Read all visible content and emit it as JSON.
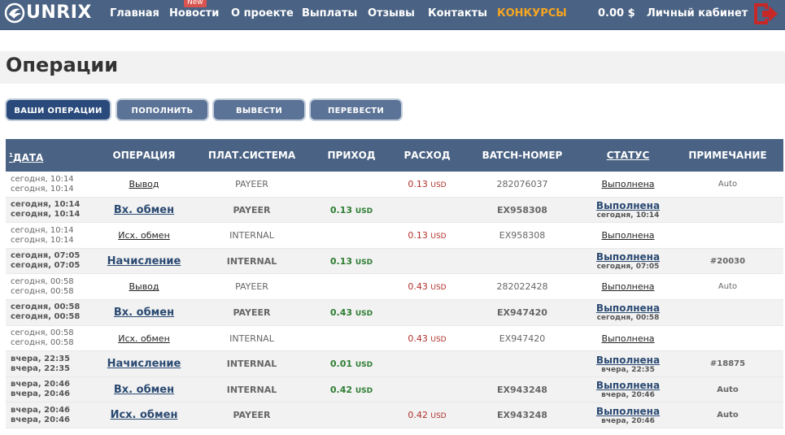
{
  "header": {
    "logo_text": "UNRIX",
    "nav": [
      {
        "label": "Главная"
      },
      {
        "label": "Новости",
        "badge": "New"
      },
      {
        "label": "О проекте"
      },
      {
        "label": "Выплаты"
      },
      {
        "label": "Отзывы"
      },
      {
        "label": "Контакты"
      },
      {
        "label": "КОНКУРСЫ"
      }
    ],
    "balance": "0.00 $",
    "cabinet": "Личный кабинет",
    "colors": {
      "bar": "#4a6283",
      "contest": "#f5a623",
      "logout": "#c62828"
    }
  },
  "page": {
    "title": "Операции"
  },
  "buttons": [
    {
      "label": "ВАШИ ОПЕРАЦИИ",
      "active": true
    },
    {
      "label": "ПОПОЛНИТЬ"
    },
    {
      "label": "ВЫВЕСТИ"
    },
    {
      "label": "ПЕРЕВЕСТИ"
    }
  ],
  "table": {
    "sort_marker": "1",
    "headers": [
      "ДАТА",
      "ОПЕРАЦИЯ",
      "ПЛАТ.СИСТЕМА",
      "ПРИХОД",
      "РАСХОД",
      "BATCH-НОМЕР",
      "СТАТУС",
      "ПРИМЕЧАНИЕ"
    ],
    "rows": [
      {
        "bold": false,
        "date1": "сегодня, 10:14",
        "date2": "сегодня, 10:14",
        "op": "Вывод",
        "sys": "PAYEER",
        "inc": "",
        "inc_unit": "",
        "exp": "0.13",
        "exp_unit": "USD",
        "batch": "282076037",
        "status": "Выполнена",
        "status_time": "",
        "note": "Auto"
      },
      {
        "bold": true,
        "date1": "сегодня, 10:14",
        "date2": "сегодня, 10:14",
        "op": "Вх. обмен",
        "sys": "PAYEER",
        "inc": "0.13",
        "inc_unit": "USD",
        "exp": "",
        "exp_unit": "",
        "batch": "EX958308",
        "status": "Выполнена",
        "status_time": "сегодня, 10:14",
        "note": ""
      },
      {
        "bold": false,
        "date1": "сегодня, 10:14",
        "date2": "сегодня, 10:14",
        "op": "Исх. обмен",
        "sys": "INTERNAL",
        "inc": "",
        "inc_unit": "",
        "exp": "0.13",
        "exp_unit": "USD",
        "batch": "EX958308",
        "status": "Выполнена",
        "status_time": "",
        "note": ""
      },
      {
        "bold": true,
        "date1": "сегодня, 07:05",
        "date2": "сегодня, 07:05",
        "op": "Начисление",
        "sys": "INTERNAL",
        "inc": "0.13",
        "inc_unit": "USD",
        "exp": "",
        "exp_unit": "",
        "batch": "",
        "status": "Выполнена",
        "status_time": "сегодня, 07:05",
        "note": "#20030"
      },
      {
        "bold": false,
        "date1": "сегодня, 00:58",
        "date2": "сегодня, 00:58",
        "op": "Вывод",
        "sys": "PAYEER",
        "inc": "",
        "inc_unit": "",
        "exp": "0.43",
        "exp_unit": "USD",
        "batch": "282022428",
        "status": "Выполнена",
        "status_time": "",
        "note": "Auto"
      },
      {
        "bold": true,
        "date1": "сегодня, 00:58",
        "date2": "сегодня, 00:58",
        "op": "Вх. обмен",
        "sys": "PAYEER",
        "inc": "0.43",
        "inc_unit": "USD",
        "exp": "",
        "exp_unit": "",
        "batch": "EX947420",
        "status": "Выполнена",
        "status_time": "сегодня, 00:58",
        "note": ""
      },
      {
        "bold": false,
        "date1": "сегодня, 00:58",
        "date2": "сегодня, 00:58",
        "op": "Исх. обмен",
        "sys": "INTERNAL",
        "inc": "",
        "inc_unit": "",
        "exp": "0.43",
        "exp_unit": "USD",
        "batch": "EX947420",
        "status": "Выполнена",
        "status_time": "",
        "note": ""
      },
      {
        "bold": true,
        "date1": "вчера, 22:35",
        "date2": "вчера, 22:35",
        "op": "Начисление",
        "sys": "INTERNAL",
        "inc": "0.01",
        "inc_unit": "USD",
        "exp": "",
        "exp_unit": "",
        "batch": "",
        "status": "Выполнена",
        "status_time": "вчера, 22:35",
        "note": "#18875"
      },
      {
        "bold": true,
        "date1": "вчера, 20:46",
        "date2": "вчера, 20:46",
        "op": "Вх. обмен",
        "sys": "INTERNAL",
        "inc": "0.42",
        "inc_unit": "USD",
        "exp": "",
        "exp_unit": "",
        "batch": "EX943248",
        "status": "Выполнена",
        "status_time": "вчера, 20:46",
        "note": "Auto"
      },
      {
        "bold": true,
        "date1": "вчера, 20:46",
        "date2": "вчера, 20:46",
        "op": "Исх. обмен",
        "sys": "PAYEER",
        "inc": "",
        "inc_unit": "",
        "exp": "0.42",
        "exp_unit": "USD",
        "batch": "EX943248",
        "status": "Выполнена",
        "status_time": "вчера, 20:46",
        "note": "Auto"
      }
    ]
  }
}
